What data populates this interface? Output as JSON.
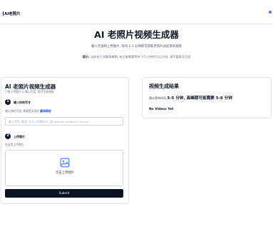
{
  "header": {
    "logo": "AI老照片"
  },
  "hero": {
    "title": "AI 老照片视频生成器",
    "subtitle": "输入咒语和上传图片, 等待 2-3 分钟即可获取老照片动起来的视频",
    "tip_label": "提示:",
    "tip_text": "当前处于流量高峰期, 有可能需要等待 3-5 分钟才可以生成, 请不要离开页面"
  },
  "form": {
    "title": "AI 老照片视频生成器",
    "description": "只需上传图片 & 输入咒语, 即可生成视频",
    "step1": {
      "number": "1",
      "label": "输入你的咒令",
      "hint": "输入你的咒语, 需要是英语的",
      "hint_link": "翻译网站",
      "input_value": "",
      "input_placeholder": "输入咒令, 格式: 什么人在做什么, 如: woman smiling in the air"
    },
    "step2": {
      "number": "2",
      "label": "上传图片",
      "hint": "在这里上传图片",
      "upload_text": "点击上传图片"
    },
    "submit_label": "Submit"
  },
  "result": {
    "title": "视频生成结果",
    "wait_prefix": "预计等待时间",
    "wait_value": "3-5 分钟, 高峰期可能需要 5-8 分钟",
    "empty_text": "No Videos Yet"
  },
  "colors": {
    "accent": "#3b82f6",
    "link": "#1d4ed8",
    "button": "#0b1220",
    "border": "#e5e7eb"
  },
  "icons": {
    "upload": "image-icon",
    "nav": "menu-dot-icon"
  }
}
